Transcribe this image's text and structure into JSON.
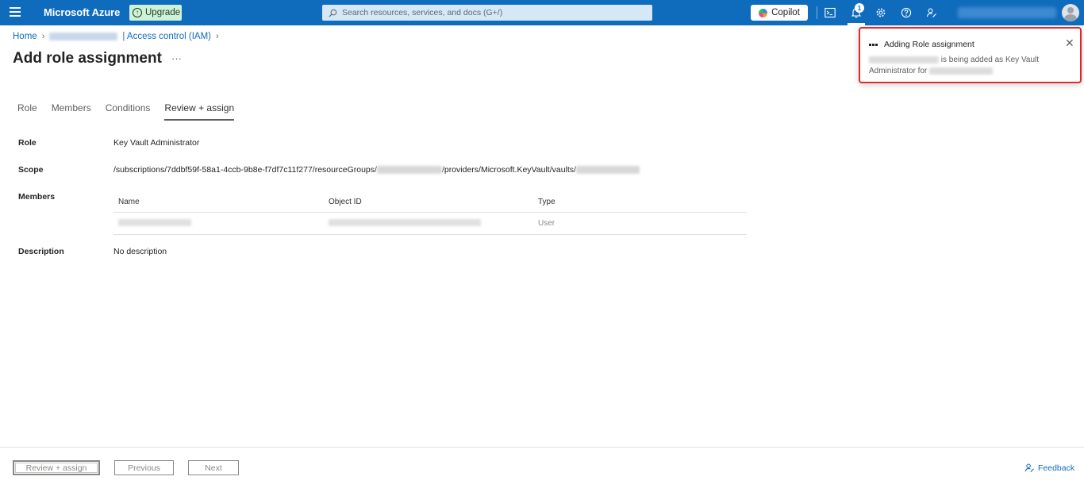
{
  "topbar": {
    "brand": "Microsoft Azure",
    "upgrade_label": "Upgrade",
    "search_placeholder": "Search resources, services, and docs (G+/)",
    "copilot_label": "Copilot",
    "notification_count": "1",
    "accent_color": "#0f6cbd",
    "icons": [
      "menu-icon",
      "cloud-shell-icon",
      "bell-icon",
      "gear-icon",
      "help-icon",
      "feedback-person-icon"
    ]
  },
  "breadcrumb": {
    "home": "Home",
    "iam": "| Access control (IAM)"
  },
  "page": {
    "title": "Add role assignment",
    "more": "···"
  },
  "tabs": [
    {
      "label": "Role"
    },
    {
      "label": "Members"
    },
    {
      "label": "Conditions"
    },
    {
      "label": "Review + assign",
      "active": true
    }
  ],
  "review": {
    "role_label": "Role",
    "role_value": "Key Vault Administrator",
    "scope_label": "Scope",
    "scope_part1": "/subscriptions/7ddbf59f-58a1-4ccb-9b8e-f7df7c11f277/resourceGroups/",
    "scope_part2": "/providers/Microsoft.KeyVault/vaults/",
    "members_label": "Members",
    "members_table": {
      "headers": [
        "Name",
        "Object ID",
        "Type"
      ],
      "rows": [
        {
          "type": "User"
        }
      ]
    },
    "description_label": "Description",
    "description_value": "No description"
  },
  "footer": {
    "review_assign": "Review + assign",
    "previous": "Previous",
    "next": "Next",
    "feedback": "Feedback"
  },
  "notification": {
    "title": "Adding Role assignment",
    "body_part1": "is being added as Key Vault",
    "body_part2": "Administrator for",
    "highlight_color": "#e02828"
  }
}
